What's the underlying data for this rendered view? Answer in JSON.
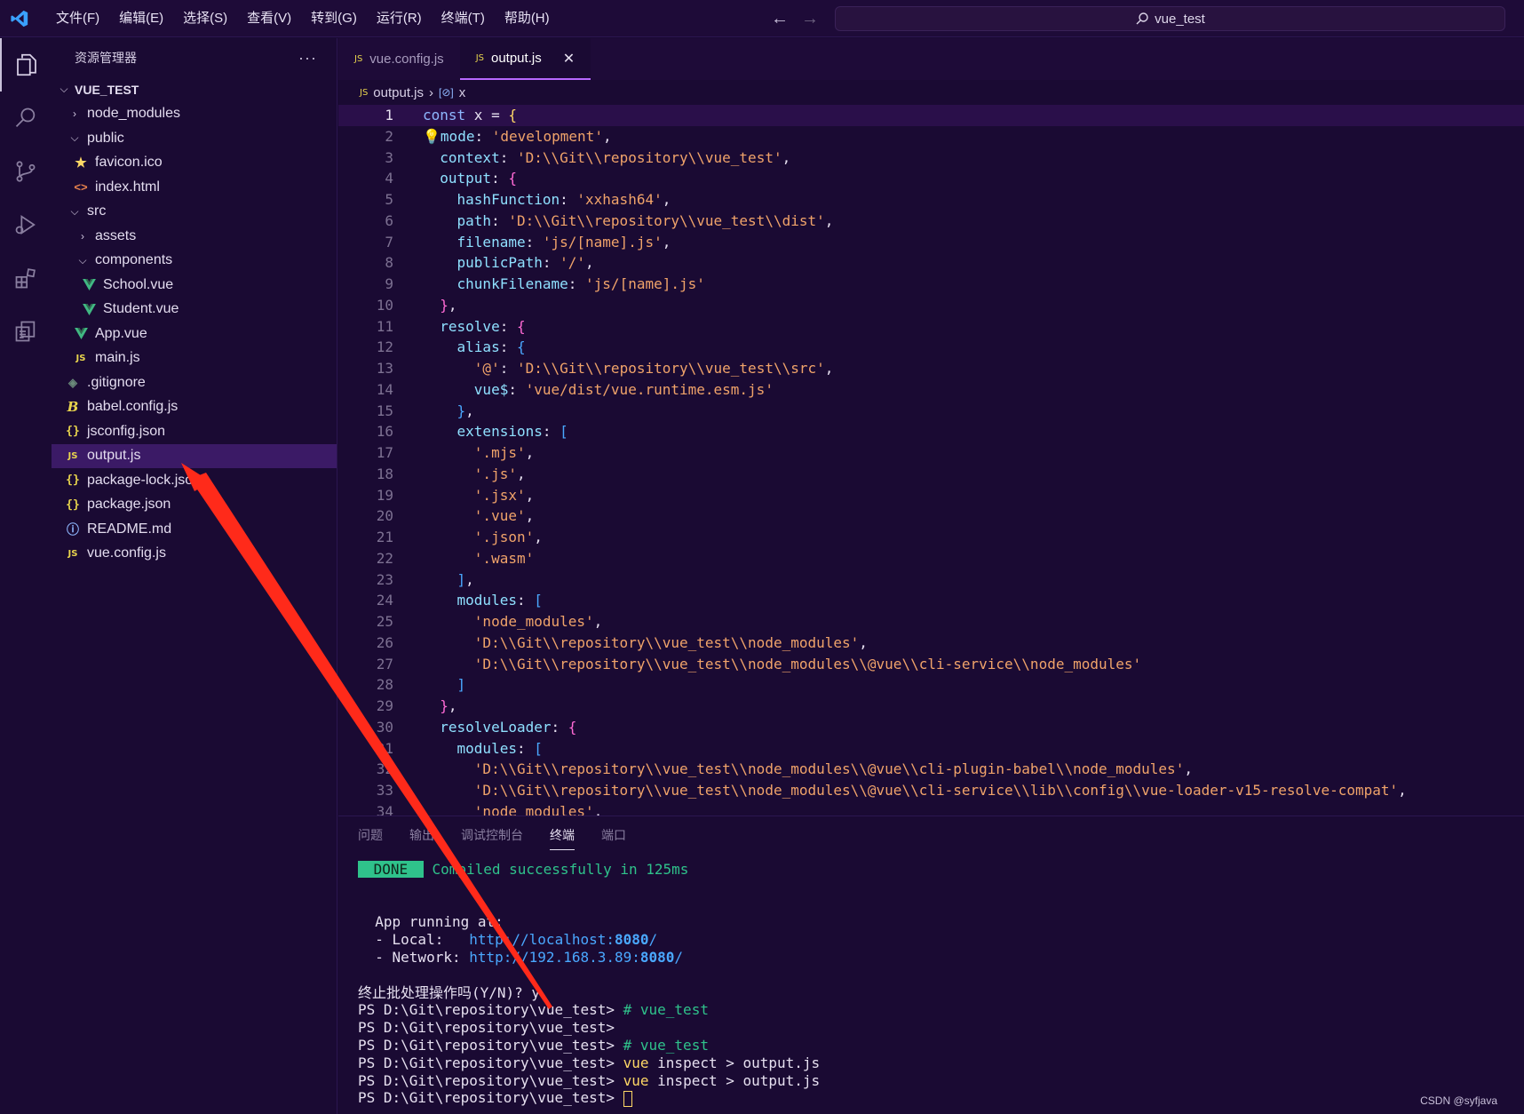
{
  "menu": [
    "文件(F)",
    "编辑(E)",
    "选择(S)",
    "查看(V)",
    "转到(G)",
    "运行(R)",
    "终端(T)",
    "帮助(H)"
  ],
  "search_text": "vue_test",
  "sidebar": {
    "title": "资源管理器",
    "more": "···",
    "root": "VUE_TEST",
    "items": [
      {
        "label": "node_modules",
        "type": "folder-closed",
        "depth": 1
      },
      {
        "label": "public",
        "type": "folder-open",
        "depth": 1
      },
      {
        "label": "favicon.ico",
        "type": "star",
        "depth": 2
      },
      {
        "label": "index.html",
        "type": "html",
        "depth": 2
      },
      {
        "label": "src",
        "type": "folder-open",
        "depth": 1
      },
      {
        "label": "assets",
        "type": "folder-closed",
        "depth": 2
      },
      {
        "label": "components",
        "type": "folder-open",
        "depth": 2
      },
      {
        "label": "School.vue",
        "type": "vue",
        "depth": 3
      },
      {
        "label": "Student.vue",
        "type": "vue",
        "depth": 3
      },
      {
        "label": "App.vue",
        "type": "vue",
        "depth": 2
      },
      {
        "label": "main.js",
        "type": "js",
        "depth": 2
      },
      {
        "label": ".gitignore",
        "type": "git",
        "depth": 1
      },
      {
        "label": "babel.config.js",
        "type": "babel",
        "depth": 1
      },
      {
        "label": "jsconfig.json",
        "type": "json",
        "depth": 1
      },
      {
        "label": "output.js",
        "type": "js",
        "depth": 1,
        "selected": true
      },
      {
        "label": "package-lock.json",
        "type": "json",
        "depth": 1
      },
      {
        "label": "package.json",
        "type": "json",
        "depth": 1
      },
      {
        "label": "README.md",
        "type": "info",
        "depth": 1
      },
      {
        "label": "vue.config.js",
        "type": "js",
        "depth": 1
      }
    ]
  },
  "tabs": [
    {
      "label": "vue.config.js",
      "active": false
    },
    {
      "label": "output.js",
      "active": true
    }
  ],
  "breadcrumb": {
    "file": "output.js",
    "symbol": "x"
  },
  "code": [
    [
      [
        "k",
        "const "
      ],
      [
        "w",
        "x = "
      ],
      [
        "b1",
        "{"
      ]
    ],
    [
      [
        "bulb",
        "💡"
      ],
      [
        "p",
        "mode"
      ],
      [
        "w",
        ": "
      ],
      [
        "s",
        "'development'"
      ],
      [
        "w",
        ","
      ]
    ],
    [
      [
        "w",
        "  "
      ],
      [
        "p",
        "context"
      ],
      [
        "w",
        ": "
      ],
      [
        "s",
        "'D:\\\\Git\\\\repository\\\\vue_test'"
      ],
      [
        "w",
        ","
      ]
    ],
    [
      [
        "w",
        "  "
      ],
      [
        "p",
        "output"
      ],
      [
        "w",
        ": "
      ],
      [
        "b2",
        "{"
      ]
    ],
    [
      [
        "w",
        "    "
      ],
      [
        "p",
        "hashFunction"
      ],
      [
        "w",
        ": "
      ],
      [
        "s",
        "'xxhash64'"
      ],
      [
        "w",
        ","
      ]
    ],
    [
      [
        "w",
        "    "
      ],
      [
        "p",
        "path"
      ],
      [
        "w",
        ": "
      ],
      [
        "s",
        "'D:\\\\Git\\\\repository\\\\vue_test\\\\dist'"
      ],
      [
        "w",
        ","
      ]
    ],
    [
      [
        "w",
        "    "
      ],
      [
        "p",
        "filename"
      ],
      [
        "w",
        ": "
      ],
      [
        "s",
        "'js/[name].js'"
      ],
      [
        "w",
        ","
      ]
    ],
    [
      [
        "w",
        "    "
      ],
      [
        "p",
        "publicPath"
      ],
      [
        "w",
        ": "
      ],
      [
        "s",
        "'/'"
      ],
      [
        "w",
        ","
      ]
    ],
    [
      [
        "w",
        "    "
      ],
      [
        "p",
        "chunkFilename"
      ],
      [
        "w",
        ": "
      ],
      [
        "s",
        "'js/[name].js'"
      ]
    ],
    [
      [
        "w",
        "  "
      ],
      [
        "b2",
        "}"
      ],
      [
        "w",
        ","
      ]
    ],
    [
      [
        "w",
        "  "
      ],
      [
        "p",
        "resolve"
      ],
      [
        "w",
        ": "
      ],
      [
        "b2",
        "{"
      ]
    ],
    [
      [
        "w",
        "    "
      ],
      [
        "p",
        "alias"
      ],
      [
        "w",
        ": "
      ],
      [
        "b3",
        "{"
      ]
    ],
    [
      [
        "w",
        "      "
      ],
      [
        "s",
        "'@'"
      ],
      [
        "w",
        ": "
      ],
      [
        "s",
        "'D:\\\\Git\\\\repository\\\\vue_test\\\\src'"
      ],
      [
        "w",
        ","
      ]
    ],
    [
      [
        "w",
        "      "
      ],
      [
        "p",
        "vue$"
      ],
      [
        "w",
        ": "
      ],
      [
        "s",
        "'vue/dist/vue.runtime.esm.js'"
      ]
    ],
    [
      [
        "w",
        "    "
      ],
      [
        "b3",
        "}"
      ],
      [
        "w",
        ","
      ]
    ],
    [
      [
        "w",
        "    "
      ],
      [
        "p",
        "extensions"
      ],
      [
        "w",
        ": "
      ],
      [
        "b3",
        "["
      ]
    ],
    [
      [
        "w",
        "      "
      ],
      [
        "s",
        "'.mjs'"
      ],
      [
        "w",
        ","
      ]
    ],
    [
      [
        "w",
        "      "
      ],
      [
        "s",
        "'.js'"
      ],
      [
        "w",
        ","
      ]
    ],
    [
      [
        "w",
        "      "
      ],
      [
        "s",
        "'.jsx'"
      ],
      [
        "w",
        ","
      ]
    ],
    [
      [
        "w",
        "      "
      ],
      [
        "s",
        "'.vue'"
      ],
      [
        "w",
        ","
      ]
    ],
    [
      [
        "w",
        "      "
      ],
      [
        "s",
        "'.json'"
      ],
      [
        "w",
        ","
      ]
    ],
    [
      [
        "w",
        "      "
      ],
      [
        "s",
        "'.wasm'"
      ]
    ],
    [
      [
        "w",
        "    "
      ],
      [
        "b3",
        "]"
      ],
      [
        "w",
        ","
      ]
    ],
    [
      [
        "w",
        "    "
      ],
      [
        "p",
        "modules"
      ],
      [
        "w",
        ": "
      ],
      [
        "b3",
        "["
      ]
    ],
    [
      [
        "w",
        "      "
      ],
      [
        "s",
        "'node_modules'"
      ],
      [
        "w",
        ","
      ]
    ],
    [
      [
        "w",
        "      "
      ],
      [
        "s",
        "'D:\\\\Git\\\\repository\\\\vue_test\\\\node_modules'"
      ],
      [
        "w",
        ","
      ]
    ],
    [
      [
        "w",
        "      "
      ],
      [
        "s",
        "'D:\\\\Git\\\\repository\\\\vue_test\\\\node_modules\\\\@vue\\\\cli-service\\\\node_modules'"
      ]
    ],
    [
      [
        "w",
        "    "
      ],
      [
        "b3",
        "]"
      ]
    ],
    [
      [
        "w",
        "  "
      ],
      [
        "b2",
        "}"
      ],
      [
        "w",
        ","
      ]
    ],
    [
      [
        "w",
        "  "
      ],
      [
        "p",
        "resolveLoader"
      ],
      [
        "w",
        ": "
      ],
      [
        "b2",
        "{"
      ]
    ],
    [
      [
        "w",
        "    "
      ],
      [
        "p",
        "modules"
      ],
      [
        "w",
        ": "
      ],
      [
        "b3",
        "["
      ]
    ],
    [
      [
        "w",
        "      "
      ],
      [
        "s",
        "'D:\\\\Git\\\\repository\\\\vue_test\\\\node_modules\\\\@vue\\\\cli-plugin-babel\\\\node_modules'"
      ],
      [
        "w",
        ","
      ]
    ],
    [
      [
        "w",
        "      "
      ],
      [
        "s",
        "'D:\\\\Git\\\\repository\\\\vue_test\\\\node_modules\\\\@vue\\\\cli-service\\\\lib\\\\config\\\\vue-loader-v15-resolve-compat'"
      ],
      [
        "w",
        ","
      ]
    ],
    [
      [
        "w",
        "      "
      ],
      [
        "s",
        "'node_modules'"
      ],
      [
        "w",
        ","
      ]
    ]
  ],
  "panel": {
    "tabs": [
      {
        "label": "问题",
        "active": false
      },
      {
        "label": "输出",
        "active": false
      },
      {
        "label": "调试控制台",
        "active": false
      },
      {
        "label": "终端",
        "active": true
      },
      {
        "label": "端口",
        "active": false
      }
    ],
    "terminal": [
      [
        [
          "done",
          " DONE "
        ],
        [
          "w",
          " "
        ],
        [
          "green",
          "Compiled successfully in 125ms"
        ]
      ],
      [],
      [],
      [
        [
          "w",
          "  App running at:"
        ]
      ],
      [
        [
          "w",
          "  - Local:   "
        ],
        [
          "url",
          "http://localhost:"
        ],
        [
          "urlb",
          "8080"
        ],
        [
          "url",
          "/"
        ]
      ],
      [
        [
          "w",
          "  - Network: "
        ],
        [
          "url",
          "http://192.168.3.89:"
        ],
        [
          "urlb",
          "8080"
        ],
        [
          "url",
          "/"
        ]
      ],
      [],
      [
        [
          "w",
          "终止批处理操作吗(Y/N)? y"
        ]
      ],
      [
        [
          "w",
          "PS D:\\Git\\repository\\vue_test> "
        ],
        [
          "green",
          "# vue_test"
        ]
      ],
      [
        [
          "w",
          "PS D:\\Git\\repository\\vue_test>"
        ]
      ],
      [
        [
          "w",
          "PS D:\\Git\\repository\\vue_test> "
        ],
        [
          "green",
          "# vue_test"
        ]
      ],
      [
        [
          "w",
          "PS D:\\Git\\repository\\vue_test> "
        ],
        [
          "cmd",
          "vue"
        ],
        [
          "w",
          " inspect > output.js"
        ]
      ],
      [
        [
          "w",
          "PS D:\\Git\\repository\\vue_test> "
        ],
        [
          "cmd",
          "vue"
        ],
        [
          "w",
          " inspect > output.js"
        ]
      ],
      [
        [
          "w",
          "PS D:\\Git\\repository\\vue_test> "
        ],
        [
          "cursor",
          ""
        ]
      ]
    ]
  },
  "watermark": "CSDN @syfjava",
  "colors": {
    "background": "#1a0a33",
    "selection": "#3b1a66",
    "accent": "#b868ff",
    "annotation_arrow": "#ff2a1a"
  }
}
